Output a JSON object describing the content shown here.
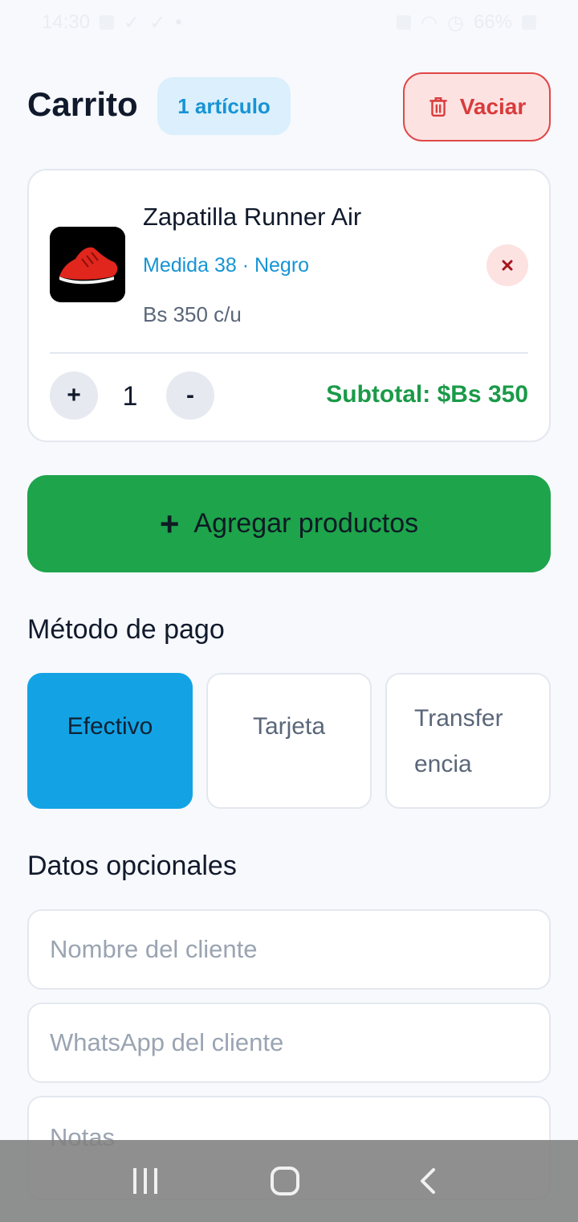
{
  "status_bar": {
    "time": "14:30",
    "battery": "66%"
  },
  "header": {
    "title": "Carrito",
    "count_badge": "1 artículo",
    "clear_label": "Vaciar"
  },
  "cart": {
    "items": [
      {
        "name": "Zapatilla Runner Air",
        "variant": "Medida 38 · Negro",
        "unit_price": "Bs 350 c/u",
        "quantity": "1",
        "subtotal": "Subtotal: $Bs 350",
        "increment_label": "+",
        "decrement_label": "-"
      }
    ]
  },
  "add_products": {
    "icon": "plus-icon",
    "label": "Agregar productos"
  },
  "payment": {
    "title": "Método de pago",
    "options": [
      {
        "label": "Efectivo",
        "selected": true
      },
      {
        "label": "Tarjeta",
        "selected": false
      },
      {
        "label_line1": "Transfer",
        "label_line2": "encia",
        "selected": false
      }
    ]
  },
  "optional": {
    "title": "Datos opcionales",
    "name_placeholder": "Nombre del cliente",
    "whatsapp_placeholder": "WhatsApp del cliente",
    "notes_placeholder": "Notas"
  },
  "colors": {
    "accent_blue": "#13a3e5",
    "success_green": "#1ea44b",
    "danger_red": "#d93b3b",
    "background": "#f7f9fc"
  }
}
